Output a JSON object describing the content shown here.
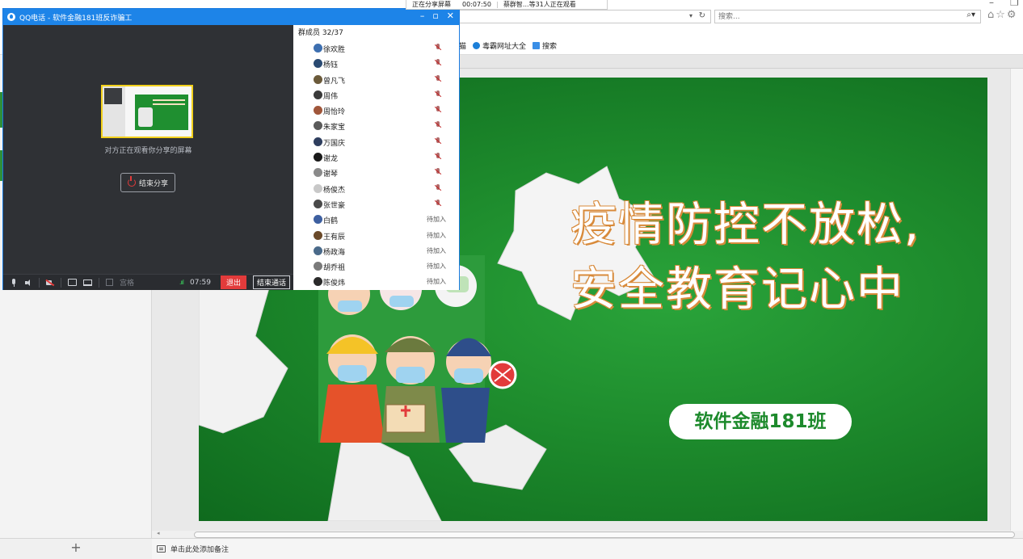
{
  "browser": {
    "search_placeholder": "搜索...",
    "favorites": [
      {
        "label": "猫",
        "color": "#3a8ee6"
      },
      {
        "label": "毒霸网址大全",
        "color": "#1c7fd8"
      },
      {
        "label": "搜索",
        "color": "#3a8ee6"
      }
    ],
    "toolbar_icons": "⌂☆⚙"
  },
  "share_bar": {
    "status": "正在分享屏幕",
    "elapsed": "00:07:50",
    "viewers": "蔡群智...等31人正在观看"
  },
  "qq_call": {
    "window_title": "QQ电话 - 软件金融181班反诈骗工",
    "watching_text": "对方正在观看你分享的屏幕",
    "end_share_label": "结束分享",
    "bottom": {
      "palace_label": "宫格",
      "signal": ".ııl",
      "timer": "07:59",
      "exit_label": "退出",
      "end_call_label": "结束通话"
    },
    "members_header": "群成员 32/37",
    "members": [
      {
        "name": "徐欢胜",
        "status": "muted",
        "avatar_color": "#3d6fb0"
      },
      {
        "name": "杨钰",
        "status": "muted",
        "avatar_color": "#2a4a72"
      },
      {
        "name": "曾凡飞",
        "status": "muted",
        "avatar_color": "#6b5a3a"
      },
      {
        "name": "周伟",
        "status": "muted",
        "avatar_color": "#3a3a3a"
      },
      {
        "name": "周怡玲",
        "status": "muted",
        "avatar_color": "#a0563a"
      },
      {
        "name": "朱家宝",
        "status": "muted",
        "avatar_color": "#5a5a5a"
      },
      {
        "name": "万国庆",
        "status": "muted",
        "avatar_color": "#2e3e5e"
      },
      {
        "name": "谢龙",
        "status": "muted",
        "avatar_color": "#1a1a1a"
      },
      {
        "name": "谢琴",
        "status": "muted",
        "avatar_color": "#8a8a8a"
      },
      {
        "name": "杨俊杰",
        "status": "muted",
        "avatar_color": "#c8c8c8"
      },
      {
        "name": "张世豪",
        "status": "muted",
        "avatar_color": "#4a4a4a"
      },
      {
        "name": "白鹤",
        "status": "waiting",
        "avatar_color": "#3d5fa0"
      },
      {
        "name": "王有辰",
        "status": "waiting",
        "avatar_color": "#6a4a2a"
      },
      {
        "name": "杨政海",
        "status": "waiting",
        "avatar_color": "#4a6a8a"
      },
      {
        "name": "胡乔祖",
        "status": "waiting",
        "avatar_color": "#7a7a7a"
      },
      {
        "name": "陈俊炜",
        "status": "waiting",
        "avatar_color": "#2a2a2a"
      }
    ],
    "waiting_label": "待加入"
  },
  "slide": {
    "title_line1": "疫情防控不放松,",
    "title_line2": "安全教育记心中",
    "class_name": "软件金融181班"
  },
  "notes": {
    "add_label": "+",
    "notes_placeholder": "单击此处添加备注"
  },
  "colors": {
    "qq_blue": "#1d84e8",
    "slide_green": "#1d8a2c",
    "exit_red": "#e23b3b",
    "title_outline": "#d88a3a"
  }
}
